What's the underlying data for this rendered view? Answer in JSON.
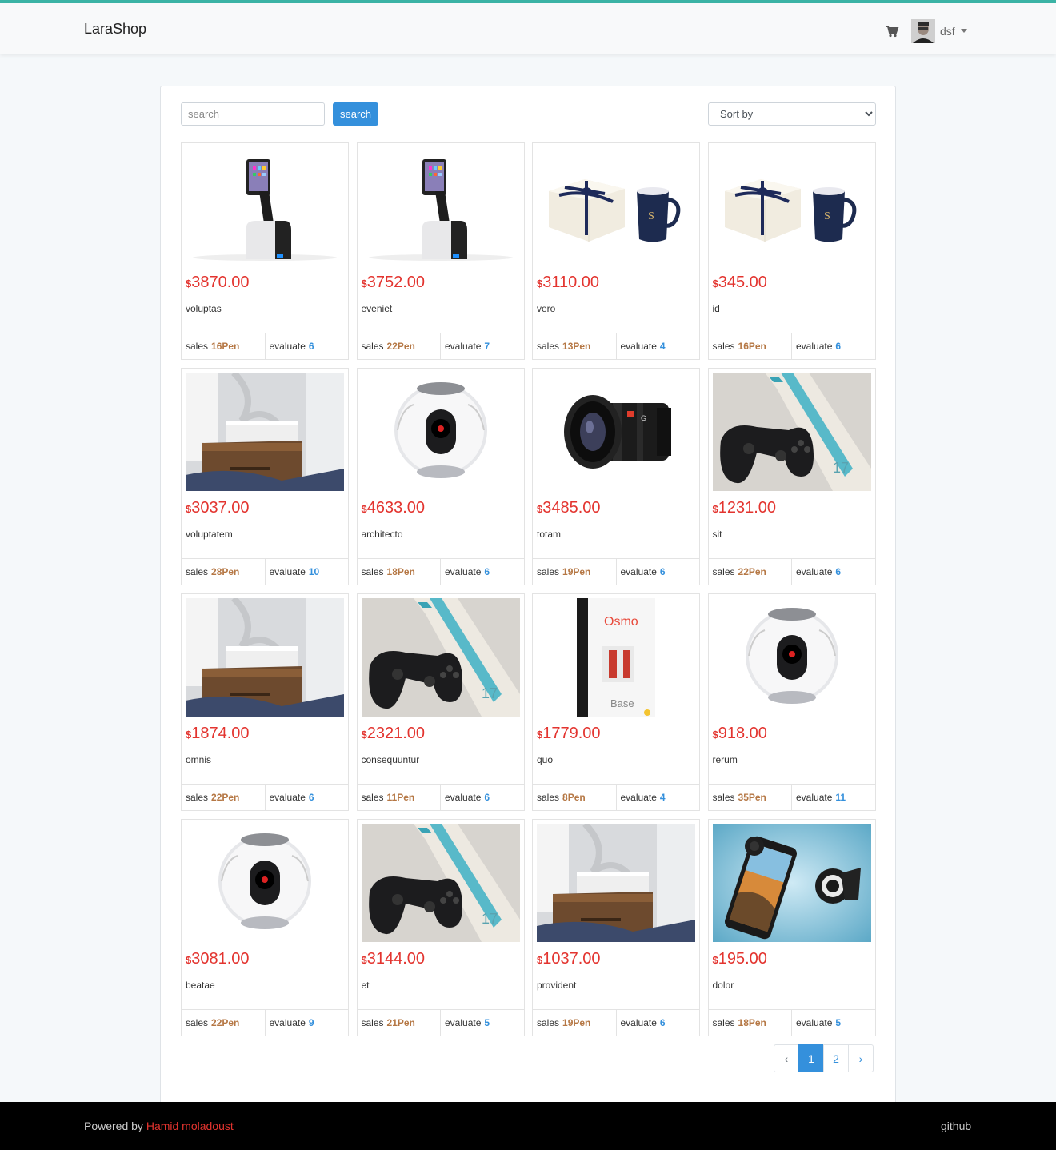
{
  "nav": {
    "brand": "LaraShop",
    "cart_icon": "cart-icon",
    "user_name": "dsf"
  },
  "filters": {
    "search_placeholder": "search",
    "search_value": "",
    "search_button": "search",
    "sort_selected": "Sort by"
  },
  "labels": {
    "currency": "$",
    "sales": "sales",
    "evaluate": "evaluate"
  },
  "products": [
    {
      "price": "3870.00",
      "title": "voluptas",
      "sales": "16Pen",
      "evaluate": "6",
      "image": "tablet-stand"
    },
    {
      "price": "3752.00",
      "title": "eveniet",
      "sales": "22Pen",
      "evaluate": "7",
      "image": "tablet-stand"
    },
    {
      "price": "3110.00",
      "title": "vero",
      "sales": "13Pen",
      "evaluate": "4",
      "image": "gift-mug"
    },
    {
      "price": "345.00",
      "title": "id",
      "sales": "16Pen",
      "evaluate": "6",
      "image": "gift-mug"
    },
    {
      "price": "3037.00",
      "title": "voluptatem",
      "sales": "28Pen",
      "evaluate": "10",
      "image": "speaker"
    },
    {
      "price": "4633.00",
      "title": "architecto",
      "sales": "18Pen",
      "evaluate": "6",
      "image": "camera-360"
    },
    {
      "price": "3485.00",
      "title": "totam",
      "sales": "19Pen",
      "evaluate": "6",
      "image": "lens"
    },
    {
      "price": "1231.00",
      "title": "sit",
      "sales": "22Pen",
      "evaluate": "6",
      "image": "gamepad"
    },
    {
      "price": "1874.00",
      "title": "omnis",
      "sales": "22Pen",
      "evaluate": "6",
      "image": "speaker"
    },
    {
      "price": "2321.00",
      "title": "consequuntur",
      "sales": "11Pen",
      "evaluate": "6",
      "image": "gamepad"
    },
    {
      "price": "1779.00",
      "title": "quo",
      "sales": "8Pen",
      "evaluate": "4",
      "image": "osmo-box"
    },
    {
      "price": "918.00",
      "title": "rerum",
      "sales": "35Pen",
      "evaluate": "11",
      "image": "camera-360"
    },
    {
      "price": "3081.00",
      "title": "beatae",
      "sales": "22Pen",
      "evaluate": "9",
      "image": "camera-360"
    },
    {
      "price": "3144.00",
      "title": "et",
      "sales": "21Pen",
      "evaluate": "5",
      "image": "gamepad"
    },
    {
      "price": "1037.00",
      "title": "provident",
      "sales": "19Pen",
      "evaluate": "6",
      "image": "speaker"
    },
    {
      "price": "195.00",
      "title": "dolor",
      "sales": "18Pen",
      "evaluate": "5",
      "image": "phone-lens"
    }
  ],
  "osmo": {
    "brand": "Osmo",
    "sub": "Base"
  },
  "pagination": {
    "prev": "‹",
    "pages": [
      "1",
      "2"
    ],
    "current": "1",
    "next": "›"
  },
  "footer": {
    "powered_by": "Powered by",
    "author": "Hamid moladoust",
    "github": "github"
  },
  "colors": {
    "accent": "#3490dc",
    "price": "#e3342f",
    "sales": "#b57744",
    "topbar_border": "#3bb3a5"
  }
}
